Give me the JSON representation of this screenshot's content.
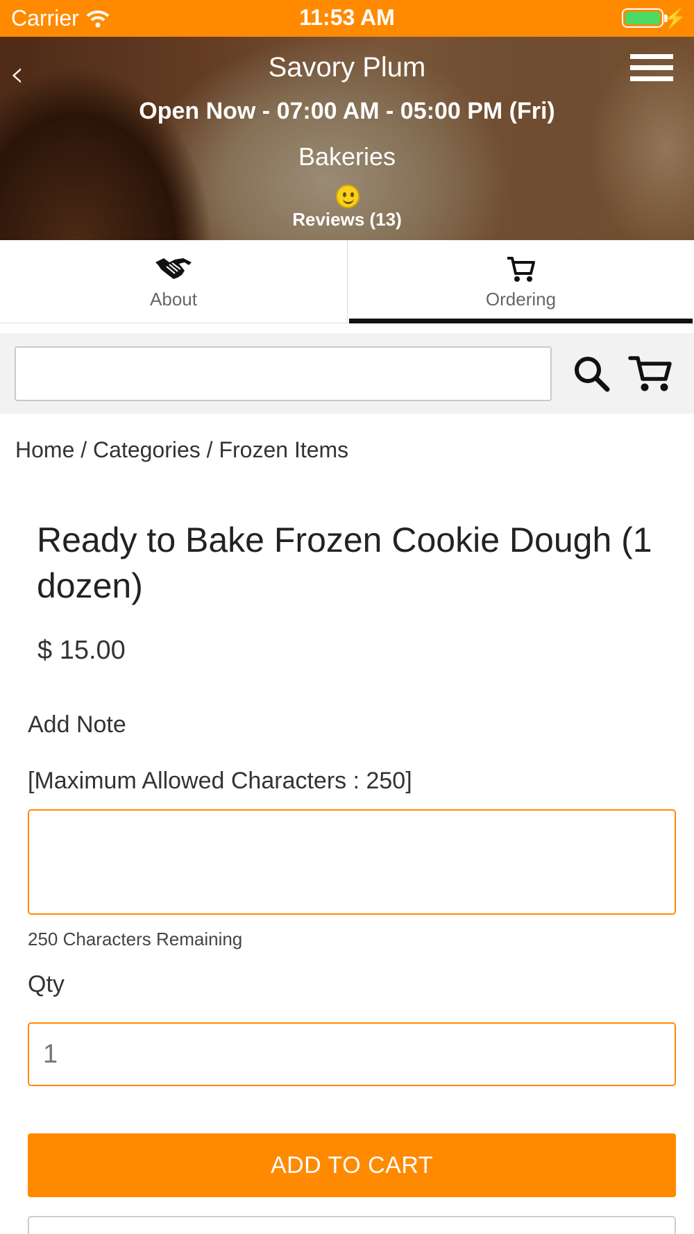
{
  "status_bar": {
    "carrier": "Carrier",
    "time": "11:53 AM",
    "battery_color": "#4cd964"
  },
  "header": {
    "title": "Savory Plum",
    "hours": "Open Now - 07:00 AM - 05:00 PM (Fri)",
    "category": "Bakeries",
    "reviews": "Reviews (13)",
    "icons": {
      "back": "chevron-left-icon",
      "menu": "hamburger-menu-icon",
      "rating": "smiley-icon"
    }
  },
  "tabs": [
    {
      "label": "About",
      "icon": "handshake-icon",
      "active": false
    },
    {
      "label": "Ordering",
      "icon": "cart-icon",
      "active": true
    }
  ],
  "search": {
    "value": "",
    "placeholder": "",
    "icons": {
      "search": "search-icon",
      "cart": "cart-icon"
    }
  },
  "breadcrumb": {
    "home": "Home",
    "sep1": " / ",
    "categories": "Categories",
    "sep2": " / ",
    "current": "Frozen Items"
  },
  "product": {
    "title": "Ready to Bake Frozen Cookie Dough (1 dozen)",
    "price": "$ 15.00"
  },
  "note": {
    "label": "Add Note",
    "max_text": "[Maximum Allowed Characters : 250]",
    "value": "",
    "remaining": "250 Characters Remaining"
  },
  "qty": {
    "label": "Qty",
    "placeholder": "1"
  },
  "actions": {
    "add_to_cart": "ADD TO CART"
  },
  "colors": {
    "accent": "#ff8a00",
    "active_tab_indicator": "#111111"
  }
}
